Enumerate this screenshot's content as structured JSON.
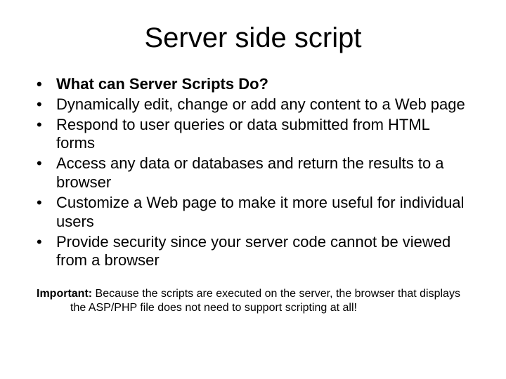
{
  "title": "Server side script",
  "bullets": [
    {
      "text": "What can Server Scripts Do?",
      "bold": true
    },
    {
      "text": "Dynamically edit, change or add any content to a Web page",
      "bold": false
    },
    {
      "text": "Respond to user queries or data submitted from HTML forms",
      "bold": false
    },
    {
      "text": "Access any data or databases and return the results to a browser",
      "bold": false
    },
    {
      "text": "Customize a Web page to make it more useful for individual users",
      "bold": false
    },
    {
      "text": "Provide security since your server code cannot be viewed from a browser",
      "bold": false
    }
  ],
  "footnote": {
    "lead": "Important:",
    "rest": " Because the scripts are executed on the server, the browser that displays the ASP/PHP file does not need to support scripting at all!"
  }
}
